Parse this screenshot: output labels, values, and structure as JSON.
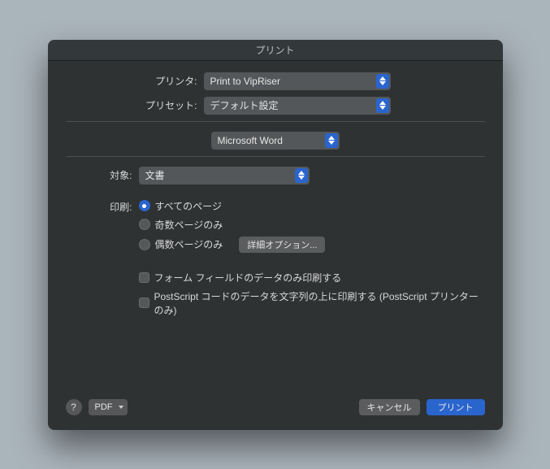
{
  "title": "プリント",
  "printer": {
    "label": "プリンタ:",
    "value": "Print to VipRiser"
  },
  "preset": {
    "label": "プリセット:",
    "value": "デフォルト設定"
  },
  "app_section": {
    "value": "Microsoft Word"
  },
  "target": {
    "label": "対象:",
    "value": "文書"
  },
  "print_scope": {
    "label": "印刷:",
    "options": {
      "all": {
        "label": "すべてのページ",
        "selected": true
      },
      "odd": {
        "label": "奇数ページのみ",
        "selected": false
      },
      "even": {
        "label": "偶数ページのみ",
        "selected": false
      }
    },
    "detail_button": "詳細オプション..."
  },
  "checks": {
    "forms_only": {
      "label": "フォーム フィールドのデータのみ印刷する",
      "checked": false
    },
    "postscript": {
      "label": "PostScript コードのデータを文字列の上に印刷する (PostScript プリンターのみ)",
      "checked": false
    }
  },
  "footer": {
    "help": "?",
    "pdf": "PDF",
    "cancel": "キャンセル",
    "print": "プリント"
  }
}
